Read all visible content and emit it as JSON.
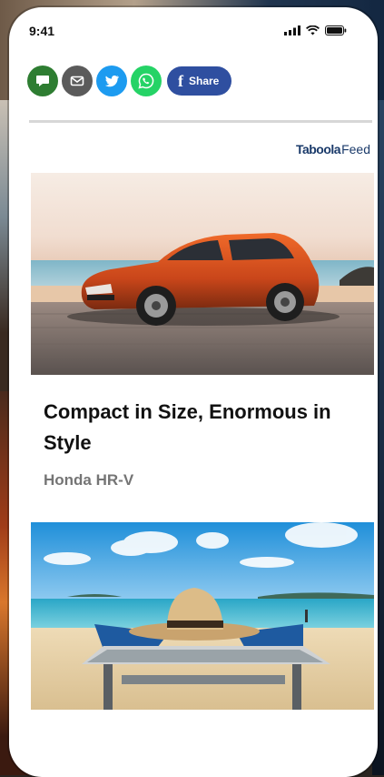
{
  "status_bar": {
    "time": "9:41"
  },
  "share_bar": {
    "buttons": [
      {
        "icon": "comment-icon",
        "color": "#2e7d32"
      },
      {
        "icon": "mail-icon",
        "color": "#5b5b5b"
      },
      {
        "icon": "twitter-icon",
        "color": "#1d9bf0"
      },
      {
        "icon": "whatsapp-icon",
        "color": "#25d366"
      }
    ],
    "share_label": "Share",
    "facebook_letter": "f"
  },
  "feed": {
    "brand": "Taboola",
    "feed_label": "Feed",
    "cards": [
      {
        "title": "Compact in Size, Enormous in Style",
        "sponsor": "Honda HR-V",
        "image": "orange-suv-on-beach"
      },
      {
        "image": "person-relaxing-on-beach-lounger"
      }
    ]
  }
}
